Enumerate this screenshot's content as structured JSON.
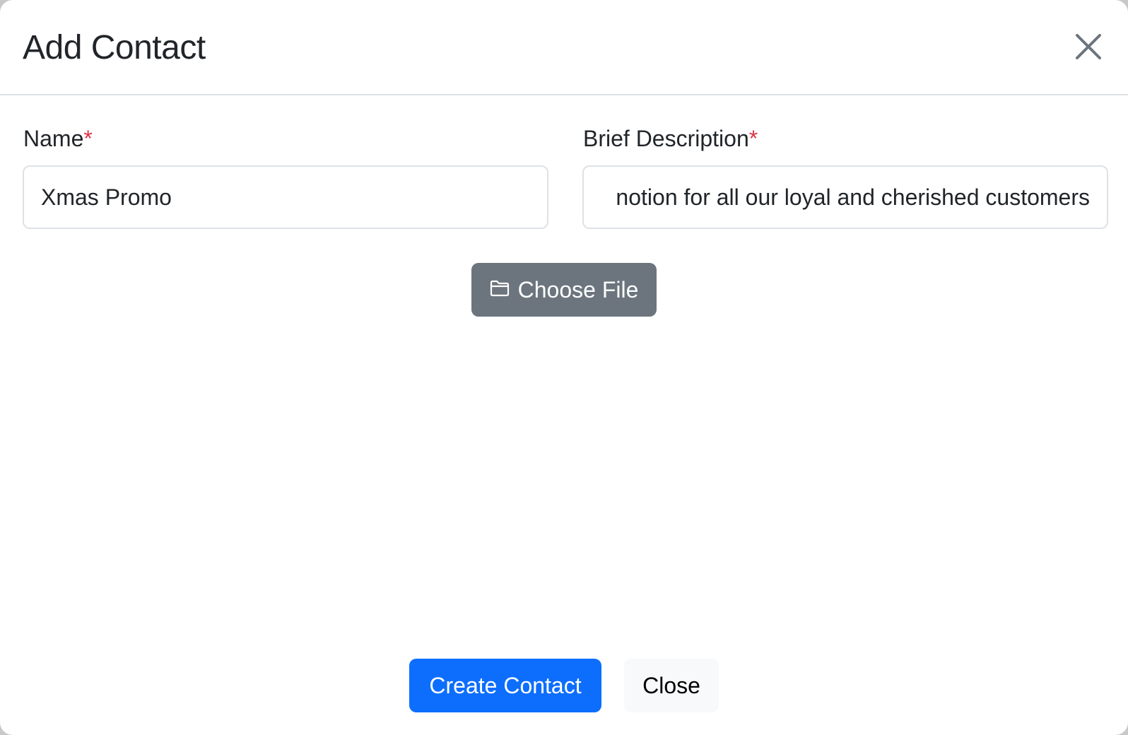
{
  "modal": {
    "title": "Add Contact"
  },
  "form": {
    "name_label": "Name",
    "name_required": "*",
    "name_value": "Xmas Promo",
    "description_label": "Brief Description",
    "description_required": "*",
    "description_value": "notion for all our loyal and cherished customers",
    "file_button_label": "Choose File"
  },
  "footer": {
    "create_label": "Create Contact",
    "close_label": "Close"
  },
  "colors": {
    "primary": "#0d6efd",
    "secondary_button": "#6c757d",
    "required": "#dc3545",
    "light_button": "#f8f9fa"
  },
  "icons": {
    "close": "close-icon",
    "file": "folder-icon"
  }
}
